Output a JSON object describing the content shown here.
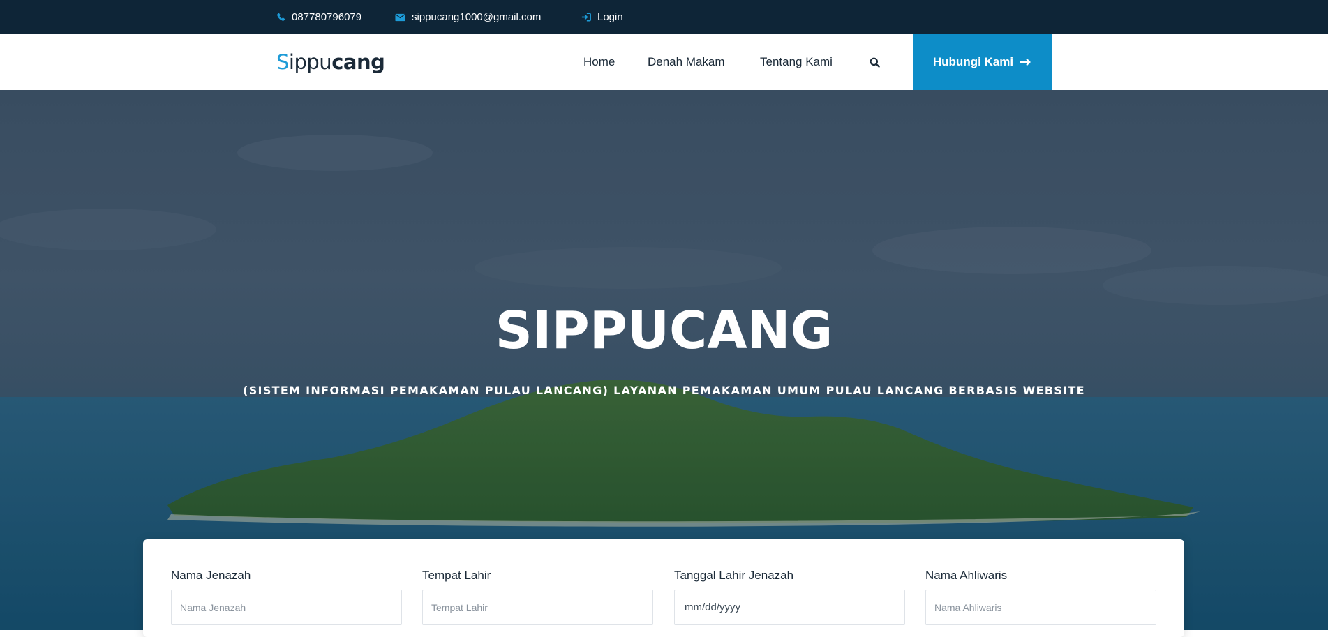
{
  "topbar": {
    "phone": "087780796079",
    "email": "sippucang1000@gmail.com",
    "login": "Login"
  },
  "navbar": {
    "logo": {
      "s": "S",
      "light": "ippu",
      "bold": "cang"
    },
    "links": [
      "Home",
      "Denah Makam",
      "Tentang Kami"
    ],
    "cta_label": "Hubungi Kami"
  },
  "hero": {
    "title": "SIPPUCANG",
    "subtitle": "(SISTEM INFORMASI PEMAKAMAN PULAU LANCANG) LAYANAN PEMAKAMAN UMUM PULAU LANCANG BERBASIS WEBSITE"
  },
  "search_form": {
    "fields": [
      {
        "label": "Nama Jenazah",
        "placeholder": "Nama Jenazah"
      },
      {
        "label": "Tempat Lahir",
        "placeholder": "Tempat Lahir"
      },
      {
        "label": "Tanggal Lahir Jenazah",
        "placeholder": "mm/dd/yyyy"
      },
      {
        "label": "Nama Ahliwaris",
        "placeholder": "Nama Ahliwaris"
      }
    ]
  },
  "icons": {
    "phone": "phone-icon",
    "email": "envelope-icon",
    "login": "sign-in-icon",
    "search": "search-icon",
    "cta": "arrow-right-icon"
  },
  "colors": {
    "topbar_bg": "#0e2537",
    "accent": "#0d8dc8",
    "icon_accent": "#1d9bd7",
    "text_dark": "#1b2a38"
  }
}
